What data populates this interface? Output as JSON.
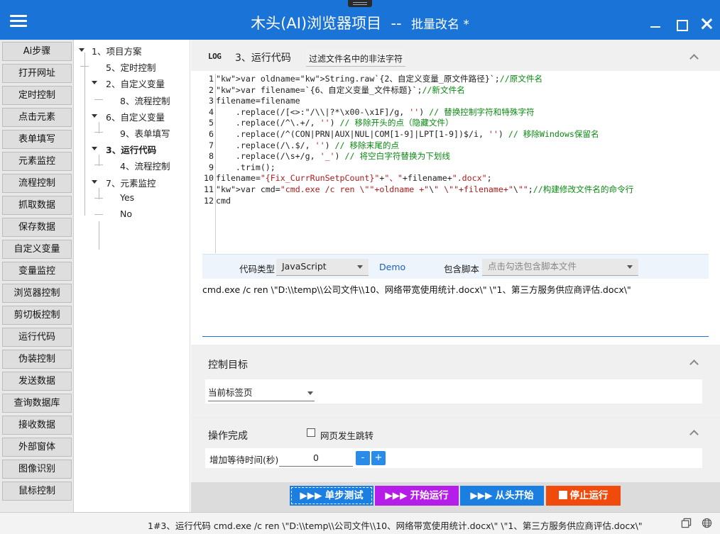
{
  "window": {
    "title": "木头(AI)浏览器项目",
    "separator": "  --  ",
    "subtitle": "批量改名 *"
  },
  "icons": {
    "menu": "hamburger-icon",
    "minimize": "minimize-icon",
    "maximize": "maximize-icon",
    "close": "close-icon",
    "log": "log-icon",
    "collapse": "chevron-up-icon",
    "restore": "restore-window-icon",
    "globe": "globe-icon"
  },
  "nav": [
    "Ai步骤",
    "打开网址",
    "定时控制",
    "点击元素",
    "表单填写",
    "元素监控",
    "流程控制",
    "抓取数据",
    "保存数据",
    "自定义变量",
    "变量监控",
    "浏览器控制",
    "剪切板控制",
    "运行代码",
    "伪装控制",
    "发送数据",
    "查询数据库",
    "接收数据",
    "外部窗体",
    "图像识别",
    "鼠标控制"
  ],
  "tree": [
    {
      "label": "1、项目方案",
      "level": 0,
      "expanded": true
    },
    {
      "label": "5、定时控制",
      "level": 1
    },
    {
      "label": "2、自定义变量",
      "level": 1,
      "expanded": true
    },
    {
      "label": "8、流程控制",
      "level": 2
    },
    {
      "label": "6、自定义变量",
      "level": 1,
      "expanded": true
    },
    {
      "label": "9、表单填写",
      "level": 2
    },
    {
      "label": "3、运行代码",
      "level": 1,
      "expanded": true,
      "selected": true
    },
    {
      "label": "4、流程控制",
      "level": 2
    },
    {
      "label": "7、元素监控",
      "level": 1,
      "expanded": true
    },
    {
      "label": "Yes",
      "level": 2
    },
    {
      "label": "No",
      "level": 2
    }
  ],
  "step": {
    "log_label": "LOG",
    "title": "3、运行代码",
    "filter_chip": "过滤文件名中的非法字符"
  },
  "code": {
    "line_numbers": [
      "1",
      "2",
      "3",
      "4",
      "5",
      "6",
      "7",
      "8",
      "9",
      "10",
      "11",
      "12"
    ],
    "lines": [
      "var oldname=String.raw`{2、自定义变量_原文件路径}`;//原文件名",
      "var filename=`{6、自定义变量_文件标题}`;//新文件名",
      "filename=filename",
      "    .replace(/[<>:\"/\\\\|?*\\x00-\\x1F]/g, '') // 替换控制字符和特殊字符",
      "    .replace(/^\\.+/, '') // 移除开头的点（隐藏文件）",
      "    .replace(/^(CON|PRN|AUX|NUL|COM[1-9]|LPT[1-9])$/i, '') // 移除Windows保留名",
      "    .replace(/\\.$/, '') // 移除末尾的点",
      "    .replace(/\\s+/g, '_') // 将空白字符替换为下划线",
      "    .trim();",
      "filename=\"{Fix_CurrRunSetpCount}\"+\"、\"+filename+\".docx\";",
      "var cmd=\"cmd.exe /c ren \\\"\"+oldname +\"\\\" \\\"\"+filename+\"\\\"\";//构建修改文件名的命令行",
      "cmd"
    ]
  },
  "options": {
    "code_type_label": "代码类型",
    "code_type_value": "JavaScript",
    "demo_link": "Demo",
    "include_script_label": "包含脚本",
    "include_script_placeholder": "点击勾选包含脚本文件"
  },
  "result": "cmd.exe /c ren \\\"D:\\\\temp\\\\公司文件\\\\10、网络带宽使用统计.docx\\\" \\\"1、第三方服务供应商评估.docx\\\"",
  "control_target": {
    "title": "控制目标",
    "value": "当前标签页"
  },
  "operation_done": {
    "title": "操作完成",
    "checkbox_label": "网页发生跳转",
    "checked": false,
    "wait_label": "增加等待时间(秒)",
    "wait_value": "0",
    "minus": "-",
    "plus": "+"
  },
  "actions": {
    "step_test": "单步测试",
    "start_run": "开始运行",
    "from_start": "从头开始",
    "stop_run": "停止运行",
    "arrow_glyph": "▶▶▶",
    "colors": {
      "step_test": "#1a7fe0",
      "start_run": "#b51ee8",
      "from_start": "#1a7fe0",
      "stop_run": "#f04a0c"
    }
  },
  "status": {
    "text": "1#3、运行代码 cmd.exe /c ren \\\"D:\\\\temp\\\\公司文件\\\\10、网络带宽使用统计.docx\\\" \\\"1、第三方服务供应商评估.docx\\\""
  },
  "colors": {
    "accent": "#1a73d6",
    "link": "#1a5fc0"
  }
}
